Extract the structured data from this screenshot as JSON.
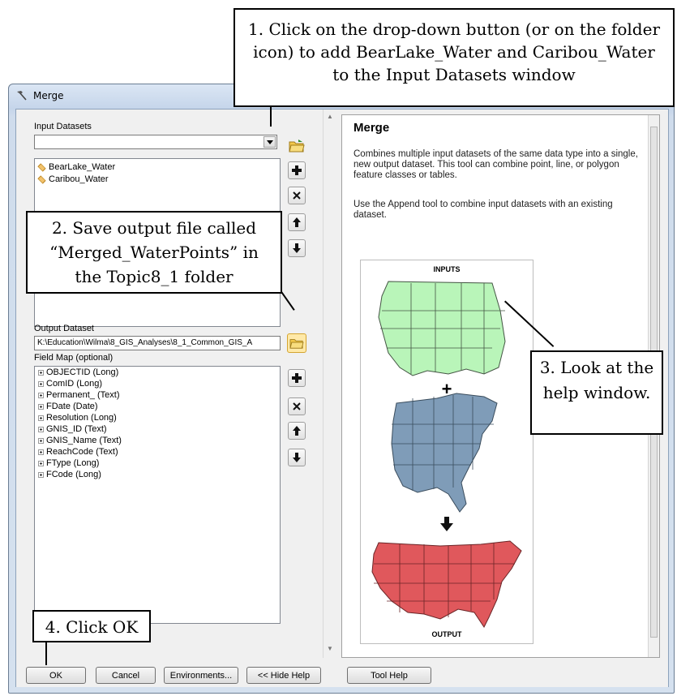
{
  "window": {
    "title": "Merge"
  },
  "left": {
    "input_label": "Input Datasets",
    "inputs": [
      "BearLake_Water",
      "Caribou_Water"
    ],
    "output_label": "Output Dataset",
    "output_path": "K:\\Education\\Wilma\\8_GIS_Analyses\\8_1_Common_GIS_A",
    "fieldmap_label": "Field Map (optional)",
    "fields": [
      "OBJECTID (Long)",
      "ComID (Long)",
      "Permanent_ (Text)",
      "FDate (Date)",
      "Resolution (Long)",
      "GNIS_ID (Text)",
      "GNIS_Name (Text)",
      "ReachCode (Text)",
      "FType (Long)",
      "FCode (Long)"
    ]
  },
  "help": {
    "title": "Merge",
    "para1": "Combines multiple input datasets of the same data type into a single, new output dataset. This tool can combine point, line, or polygon feature classes or tables.",
    "para2": "Use the Append tool to combine input datasets with an existing dataset.",
    "inputs_label": "INPUTS",
    "output_label": "OUTPUT",
    "plus": "+"
  },
  "buttons": {
    "ok": "OK",
    "cancel": "Cancel",
    "environments": "Environments...",
    "hide_help": "<< Hide Help",
    "tool_help": "Tool Help"
  },
  "callouts": {
    "c1": "1. Click on the drop-down button (or on the folder icon) to add BearLake_Water and Caribou_Water to the Input Datasets window",
    "c2": "2. Save output file called “Merged_WaterPoints” in the Topic8_1 folder",
    "c3": "3. Look at the help window.",
    "c4": "4. Click OK"
  },
  "colors": {
    "map_inputs_1": "#b9f5b9",
    "map_inputs_2": "#7f9cb8",
    "map_output": "#e0585c"
  }
}
